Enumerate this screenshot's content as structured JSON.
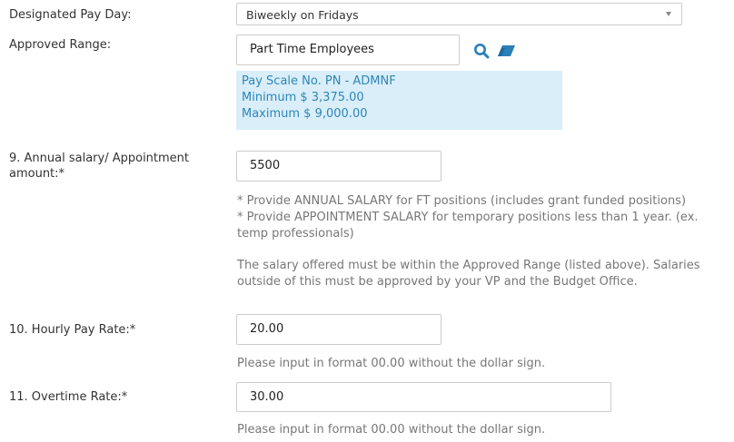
{
  "designated_pay_day": {
    "label": "Designated Pay Day:",
    "value": "Biweekly on Fridays"
  },
  "approved_range": {
    "label": "Approved Range:",
    "value": "Part Time Employees",
    "info_lines": [
      "Pay Scale No. PN - ADMNF",
      "Minimum $ 3,375.00",
      "Maximum $ 9,000.00"
    ]
  },
  "annual_salary": {
    "label_line1": "9. Annual salary/ Appointment",
    "label_line2": "amount:*",
    "value": "5500",
    "help_lines": [
      "* Provide ANNUAL SALARY for FT positions (includes grant funded positions)",
      "* Provide APPOINTMENT SALARY for temporary positions less than 1 year. (ex.",
      "temp professionals)"
    ],
    "note_lines": [
      "The salary offered must be within the Approved Range (listed above). Salaries",
      "outside of this must be approved by your VP and the Budget Office."
    ]
  },
  "hourly_pay_rate": {
    "label": "10. Hourly Pay Rate:*",
    "value": "20.00",
    "help": "Please input in format 00.00 without the dollar sign."
  },
  "overtime_rate": {
    "label": "11. Overtime Rate:*",
    "value": "30.00",
    "help": "Please input in format 00.00 without the dollar sign."
  },
  "icons": {
    "search": "search-icon",
    "clear": "eraser-icon"
  },
  "colors": {
    "info_bg": "#d9eef9",
    "info_text": "#2e86b8",
    "icon": "#2c7fb8",
    "help_text": "#777777"
  }
}
